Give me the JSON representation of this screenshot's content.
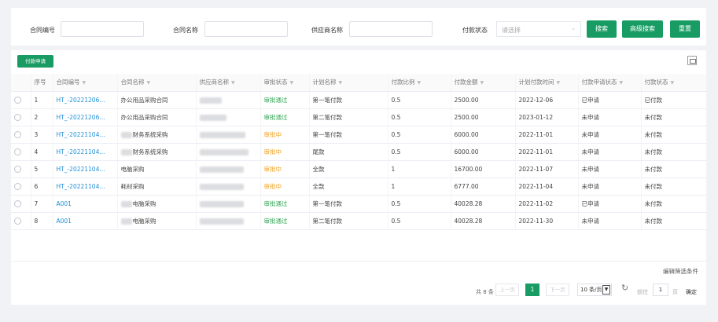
{
  "filters": {
    "contract_no_label": "合同编号",
    "contract_name_label": "合同名称",
    "supplier_label": "供应商名称",
    "payment_status_label": "付款状态",
    "payment_status_placeholder": "请选择",
    "search_label": "搜索",
    "advanced_search_label": "高级搜索",
    "reset_label": "重置"
  },
  "toolbar": {
    "apply_label": "付款申请"
  },
  "table": {
    "columns": [
      "序号",
      "合同编号",
      "合同名称",
      "供应商名称",
      "审批状态",
      "计划名称",
      "付款比例",
      "付款金额",
      "计划付款时间",
      "付款申请状态",
      "付款状态"
    ],
    "rows": [
      {
        "seq": "1",
        "contract_no": "HT_-20221206...",
        "contract_name": "办公用品采购合同",
        "approval": "审批通过",
        "approval_kind": "pass",
        "plan": "第一笔付款",
        "ratio": "0.5",
        "amount": "2500.00",
        "date": "2022-12-06",
        "apply_status": "已申请",
        "pay_status": "已付款"
      },
      {
        "seq": "2",
        "contract_no": "HT_-20221206...",
        "contract_name": "办公用品采购合同",
        "approval": "审批通过",
        "approval_kind": "pass",
        "plan": "第二笔付款",
        "ratio": "0.5",
        "amount": "2500.00",
        "date": "2023-01-12",
        "apply_status": "未申请",
        "pay_status": "未付款"
      },
      {
        "seq": "3",
        "contract_no": "HT_-20221104...",
        "contract_name": "财务系统采购",
        "approval": "审批中",
        "approval_kind": "pending",
        "plan": "第一笔付款",
        "ratio": "0.5",
        "amount": "6000.00",
        "date": "2022-11-01",
        "apply_status": "未申请",
        "pay_status": "未付款"
      },
      {
        "seq": "4",
        "contract_no": "HT_-20221104...",
        "contract_name": "财务系统采购",
        "approval": "审批中",
        "approval_kind": "pending",
        "plan": "尾款",
        "ratio": "0.5",
        "amount": "6000.00",
        "date": "2022-11-01",
        "apply_status": "未申请",
        "pay_status": "未付款"
      },
      {
        "seq": "5",
        "contract_no": "HT_-20221104...",
        "contract_name": "电脑采购",
        "approval": "审批中",
        "approval_kind": "pending",
        "plan": "全款",
        "ratio": "1",
        "amount": "16700.00",
        "date": "2022-11-07",
        "apply_status": "未申请",
        "pay_status": "未付款"
      },
      {
        "seq": "6",
        "contract_no": "HT_-20221104...",
        "contract_name": "耗材采购",
        "approval": "审批中",
        "approval_kind": "pending",
        "plan": "全款",
        "ratio": "1",
        "amount": "6777.00",
        "date": "2022-11-04",
        "apply_status": "未申请",
        "pay_status": "未付款"
      },
      {
        "seq": "7",
        "contract_no": "A001",
        "contract_name": "电脑采购",
        "approval": "审批通过",
        "approval_kind": "pass",
        "plan": "第一笔付款",
        "ratio": "0.5",
        "amount": "40028.28",
        "date": "2022-11-02",
        "apply_status": "已申请",
        "pay_status": "未付款"
      },
      {
        "seq": "8",
        "contract_no": "A001",
        "contract_name": "电脑采购",
        "approval": "审批通过",
        "approval_kind": "pass",
        "plan": "第二笔付款",
        "ratio": "0.5",
        "amount": "40028.28",
        "date": "2022-11-30",
        "apply_status": "未申请",
        "pay_status": "未付款"
      }
    ]
  },
  "edit_filter_label": "编辑筛选条件",
  "pagination": {
    "total_label": "共 8 条",
    "prev_label": "上一页",
    "current_page": "1",
    "next_label": "下一页",
    "page_size_label": "10 条/页",
    "goto_prefix": "前往",
    "goto_value": "1",
    "goto_suffix": "页",
    "confirm_label": "确定"
  },
  "colors": {
    "accent": "#199c63",
    "link": "#1f8fd6",
    "status_pass": "#2ea44f",
    "status_pending": "#f0a020"
  }
}
